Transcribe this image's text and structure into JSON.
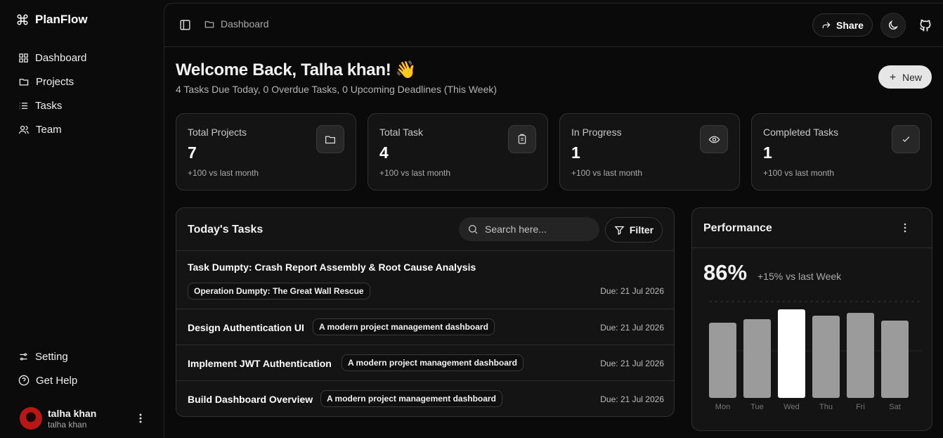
{
  "app": {
    "name": "PlanFlow"
  },
  "sidebar": {
    "items": [
      {
        "label": "Dashboard",
        "icon": "dashboard-grid-icon"
      },
      {
        "label": "Projects",
        "icon": "folder-icon"
      },
      {
        "label": "Tasks",
        "icon": "list-icon"
      },
      {
        "label": "Team",
        "icon": "users-icon"
      }
    ],
    "bottom_items": [
      {
        "label": "Setting",
        "icon": "settings-sliders-icon"
      },
      {
        "label": "Get Help",
        "icon": "help-circle-icon"
      }
    ],
    "user": {
      "name": "talha khan",
      "email": "talha khan"
    }
  },
  "topbar": {
    "breadcrumb": "Dashboard",
    "share_label": "Share"
  },
  "header": {
    "welcome": "Welcome Back, Talha khan! 👋",
    "subtitle": "4 Tasks Due Today, 0 Overdue Tasks, 0 Upcoming Deadlines (This Week)",
    "new_label": "New"
  },
  "stats": [
    {
      "label": "Total Projects",
      "value": "7",
      "change": "+100 vs last month",
      "icon": "folder-icon"
    },
    {
      "label": "Total Task",
      "value": "4",
      "change": "+100 vs last month",
      "icon": "clipboard-icon"
    },
    {
      "label": "In Progress",
      "value": "1",
      "change": "+100 vs last month",
      "icon": "eye-icon"
    },
    {
      "label": "Completed Tasks",
      "value": "1",
      "change": "+100 vs last month",
      "icon": "check-icon"
    }
  ],
  "tasks": {
    "title": "Today's Tasks",
    "search_placeholder": "Search here...",
    "filter_label": "Filter",
    "items": [
      {
        "title": "Task Dumpty: Crash Report Assembly & Root Cause Analysis",
        "project": "Operation Dumpty: The Great Wall Rescue",
        "due": "Due: 21 Jul 2026"
      },
      {
        "title": "Design Authentication UI",
        "project": "A modern project management dashboard",
        "due": "Due: 21 Jul 2026"
      },
      {
        "title": "Implement JWT Authentication",
        "project": "A modern project management dashboard",
        "due": "Due: 21 Jul 2026"
      },
      {
        "title": "Build Dashboard Overview",
        "project": "A modern project management dashboard",
        "due": "Due: 21 Jul 2026"
      }
    ]
  },
  "performance": {
    "title": "Performance",
    "value": "86%",
    "change": "+15% vs last Week"
  },
  "chart_data": {
    "type": "bar",
    "categories": [
      "Mon",
      "Tue",
      "Wed",
      "Thu",
      "Fri",
      "Sat"
    ],
    "values": [
      107,
      112,
      126,
      117,
      121,
      110
    ],
    "highlight": "Wed",
    "colors": {
      "bar": "#9b9b9b",
      "highlight": "#ffffff"
    }
  }
}
